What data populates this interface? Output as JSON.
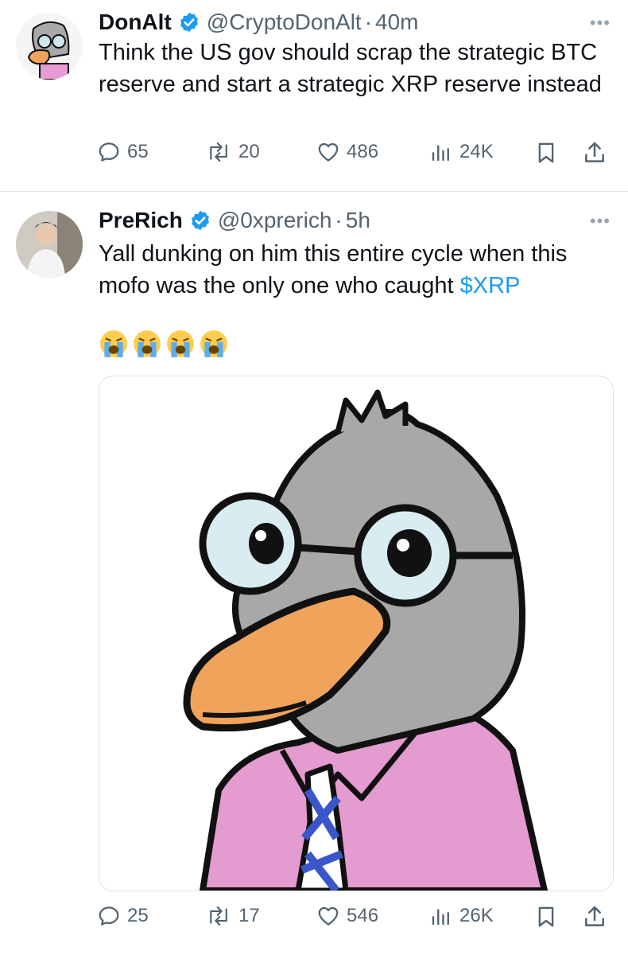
{
  "tweets": [
    {
      "name": "DonAlt",
      "handle": "@CryptoDonAlt",
      "time": "40m",
      "more": "•••",
      "text": "Think the US gov should scrap the strategic BTC reserve and start a strategic XRP reserve instead",
      "stats": {
        "replies": "65",
        "retweets": "20",
        "likes": "486",
        "views": "24K"
      }
    },
    {
      "name": "PreRich",
      "handle": "@0xprerich",
      "time": "5h",
      "more": "•••",
      "text_before": "Yall dunking on him this entire cycle when this mofo was the only one who caught ",
      "cashtag": "$XRP",
      "emojis": [
        "loudly-crying-face",
        "loudly-crying-face",
        "loudly-crying-face",
        "loudly-crying-face"
      ],
      "media_alt": "duck-with-glasses-illustration",
      "stats": {
        "replies": "25",
        "retweets": "17",
        "likes": "546",
        "views": "26K"
      }
    }
  ],
  "colors": {
    "accent": "#1d9bf0",
    "secondary_text": "#536471",
    "divider": "#dfe3e6"
  }
}
